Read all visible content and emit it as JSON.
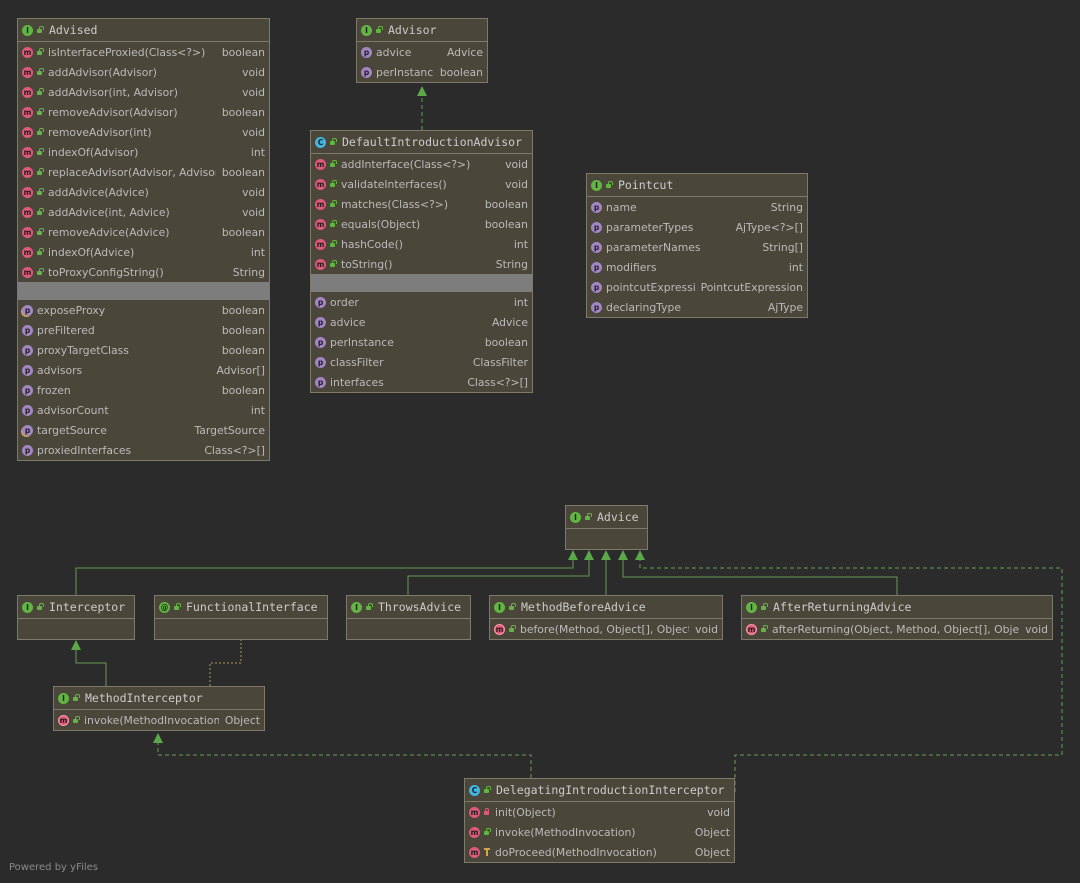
{
  "footer": {
    "text": "Powered by yFiles"
  },
  "colors": {
    "edge": "#6a9955",
    "arrow": "#5aa84a",
    "node_bg": "#4a4639",
    "node_border": "#7d7a6a",
    "separator": "#7d7d7d"
  },
  "nodes": [
    {
      "id": "advised",
      "title": "Advised",
      "kind": "I",
      "vis": "pub",
      "rows": [
        {
          "badge": "m",
          "vis": "pub",
          "name": "isInterfaceProxied(Class<?>)",
          "type": "boolean"
        },
        {
          "badge": "m",
          "vis": "pub",
          "name": "addAdvisor(Advisor)",
          "type": "void"
        },
        {
          "badge": "m",
          "vis": "pub",
          "name": "addAdvisor(int, Advisor)",
          "type": "void"
        },
        {
          "badge": "m",
          "vis": "pub",
          "name": "removeAdvisor(Advisor)",
          "type": "boolean"
        },
        {
          "badge": "m",
          "vis": "pub",
          "name": "removeAdvisor(int)",
          "type": "void"
        },
        {
          "badge": "m",
          "vis": "pub",
          "name": "indexOf(Advisor)",
          "type": "int"
        },
        {
          "badge": "m",
          "vis": "pub",
          "name": "replaceAdvisor(Advisor, Advisor)",
          "type": "boolean"
        },
        {
          "badge": "m",
          "vis": "pub",
          "name": "addAdvice(Advice)",
          "type": "void"
        },
        {
          "badge": "m",
          "vis": "pub",
          "name": "addAdvice(int, Advice)",
          "type": "void"
        },
        {
          "badge": "m",
          "vis": "pub",
          "name": "removeAdvice(Advice)",
          "type": "boolean"
        },
        {
          "badge": "m",
          "vis": "pub",
          "name": "indexOf(Advice)",
          "type": "int"
        },
        {
          "badge": "m",
          "vis": "pub",
          "name": "toProxyConfigString()",
          "type": "String"
        },
        {
          "sep": true
        },
        {
          "badge": "po",
          "name": "exposeProxy",
          "type": "boolean"
        },
        {
          "badge": "p",
          "name": "preFiltered",
          "type": "boolean"
        },
        {
          "badge": "p",
          "name": "proxyTargetClass",
          "type": "boolean"
        },
        {
          "badge": "p",
          "name": "advisors",
          "type": "Advisor[]"
        },
        {
          "badge": "p",
          "name": "frozen",
          "type": "boolean"
        },
        {
          "badge": "p",
          "name": "advisorCount",
          "type": "int"
        },
        {
          "badge": "po",
          "name": "targetSource",
          "type": "TargetSource"
        },
        {
          "badge": "p",
          "name": "proxiedInterfaces",
          "type": "Class<?>[]"
        }
      ]
    },
    {
      "id": "advisor",
      "title": "Advisor",
      "kind": "I",
      "vis": "pub",
      "rows": [
        {
          "badge": "p",
          "name": "advice",
          "type": "Advice"
        },
        {
          "badge": "p",
          "name": "perInstance",
          "type": "boolean"
        }
      ]
    },
    {
      "id": "defaultIntroductionAdvisor",
      "title": "DefaultIntroductionAdvisor",
      "kind": "C",
      "vis": "pub",
      "rows": [
        {
          "badge": "m",
          "vis": "pub",
          "name": "addInterface(Class<?>)",
          "type": "void"
        },
        {
          "badge": "m",
          "vis": "pub",
          "name": "validateInterfaces()",
          "type": "void"
        },
        {
          "badge": "m",
          "vis": "pub",
          "name": "matches(Class<?>)",
          "type": "boolean"
        },
        {
          "badge": "m",
          "vis": "pub",
          "name": "equals(Object)",
          "type": "boolean"
        },
        {
          "badge": "m",
          "vis": "pub",
          "name": "hashCode()",
          "type": "int"
        },
        {
          "badge": "m",
          "vis": "pub",
          "name": "toString()",
          "type": "String"
        },
        {
          "sep": true
        },
        {
          "badge": "p",
          "name": "order",
          "type": "int"
        },
        {
          "badge": "p",
          "name": "advice",
          "type": "Advice"
        },
        {
          "badge": "p",
          "name": "perInstance",
          "type": "boolean"
        },
        {
          "badge": "p",
          "name": "classFilter",
          "type": "ClassFilter"
        },
        {
          "badge": "p",
          "name": "interfaces",
          "type": "Class<?>[]"
        }
      ]
    },
    {
      "id": "pointcut",
      "title": "Pointcut",
      "kind": "I",
      "vis": "pub",
      "rows": [
        {
          "badge": "p",
          "name": "name",
          "type": "String"
        },
        {
          "badge": "p",
          "name": "parameterTypes",
          "type": "AjType<?>[]"
        },
        {
          "badge": "p",
          "name": "parameterNames",
          "type": "String[]"
        },
        {
          "badge": "p",
          "name": "modifiers",
          "type": "int"
        },
        {
          "badge": "p",
          "name": "pointcutExpression",
          "type": "PointcutExpression"
        },
        {
          "badge": "p",
          "name": "declaringType",
          "type": "AjType"
        }
      ]
    },
    {
      "id": "advice",
      "title": "Advice",
      "kind": "I",
      "vis": "pub",
      "rows": []
    },
    {
      "id": "interceptor",
      "title": "Interceptor",
      "kind": "I",
      "vis": "pub",
      "rows": []
    },
    {
      "id": "functionalInterface",
      "title": "FunctionalInterface",
      "kind": "A",
      "vis": "pub",
      "rows": []
    },
    {
      "id": "throwsAdvice",
      "title": "ThrowsAdvice",
      "kind": "I",
      "vis": "pub",
      "rows": []
    },
    {
      "id": "methodBeforeAdvice",
      "title": "MethodBeforeAdvice",
      "kind": "I",
      "vis": "pub",
      "rows": [
        {
          "badge": "mo",
          "vis": "pub",
          "name": "before(Method, Object[], Object)",
          "type": "void"
        }
      ]
    },
    {
      "id": "afterReturningAdvice",
      "title": "AfterReturningAdvice",
      "kind": "I",
      "vis": "pub",
      "rows": [
        {
          "badge": "mo",
          "vis": "pub",
          "name": "afterReturning(Object, Method, Object[], Object)",
          "type": "void"
        }
      ]
    },
    {
      "id": "methodInterceptor",
      "title": "MethodInterceptor",
      "kind": "I",
      "vis": "pub",
      "rows": [
        {
          "badge": "mo",
          "vis": "pub",
          "name": "invoke(MethodInvocation)",
          "type": "Object"
        }
      ]
    },
    {
      "id": "delegatingIntroductionInterceptor",
      "title": "DelegatingIntroductionInterceptor",
      "kind": "C",
      "vis": "pub",
      "rows": [
        {
          "badge": "m",
          "vis": "priv",
          "name": "init(Object)",
          "type": "void"
        },
        {
          "badge": "m",
          "vis": "pub",
          "name": "invoke(MethodInvocation)",
          "type": "Object"
        },
        {
          "badge": "m",
          "vis": "prot",
          "name": "doProceed(MethodInvocation)",
          "type": "Object"
        }
      ]
    }
  ]
}
